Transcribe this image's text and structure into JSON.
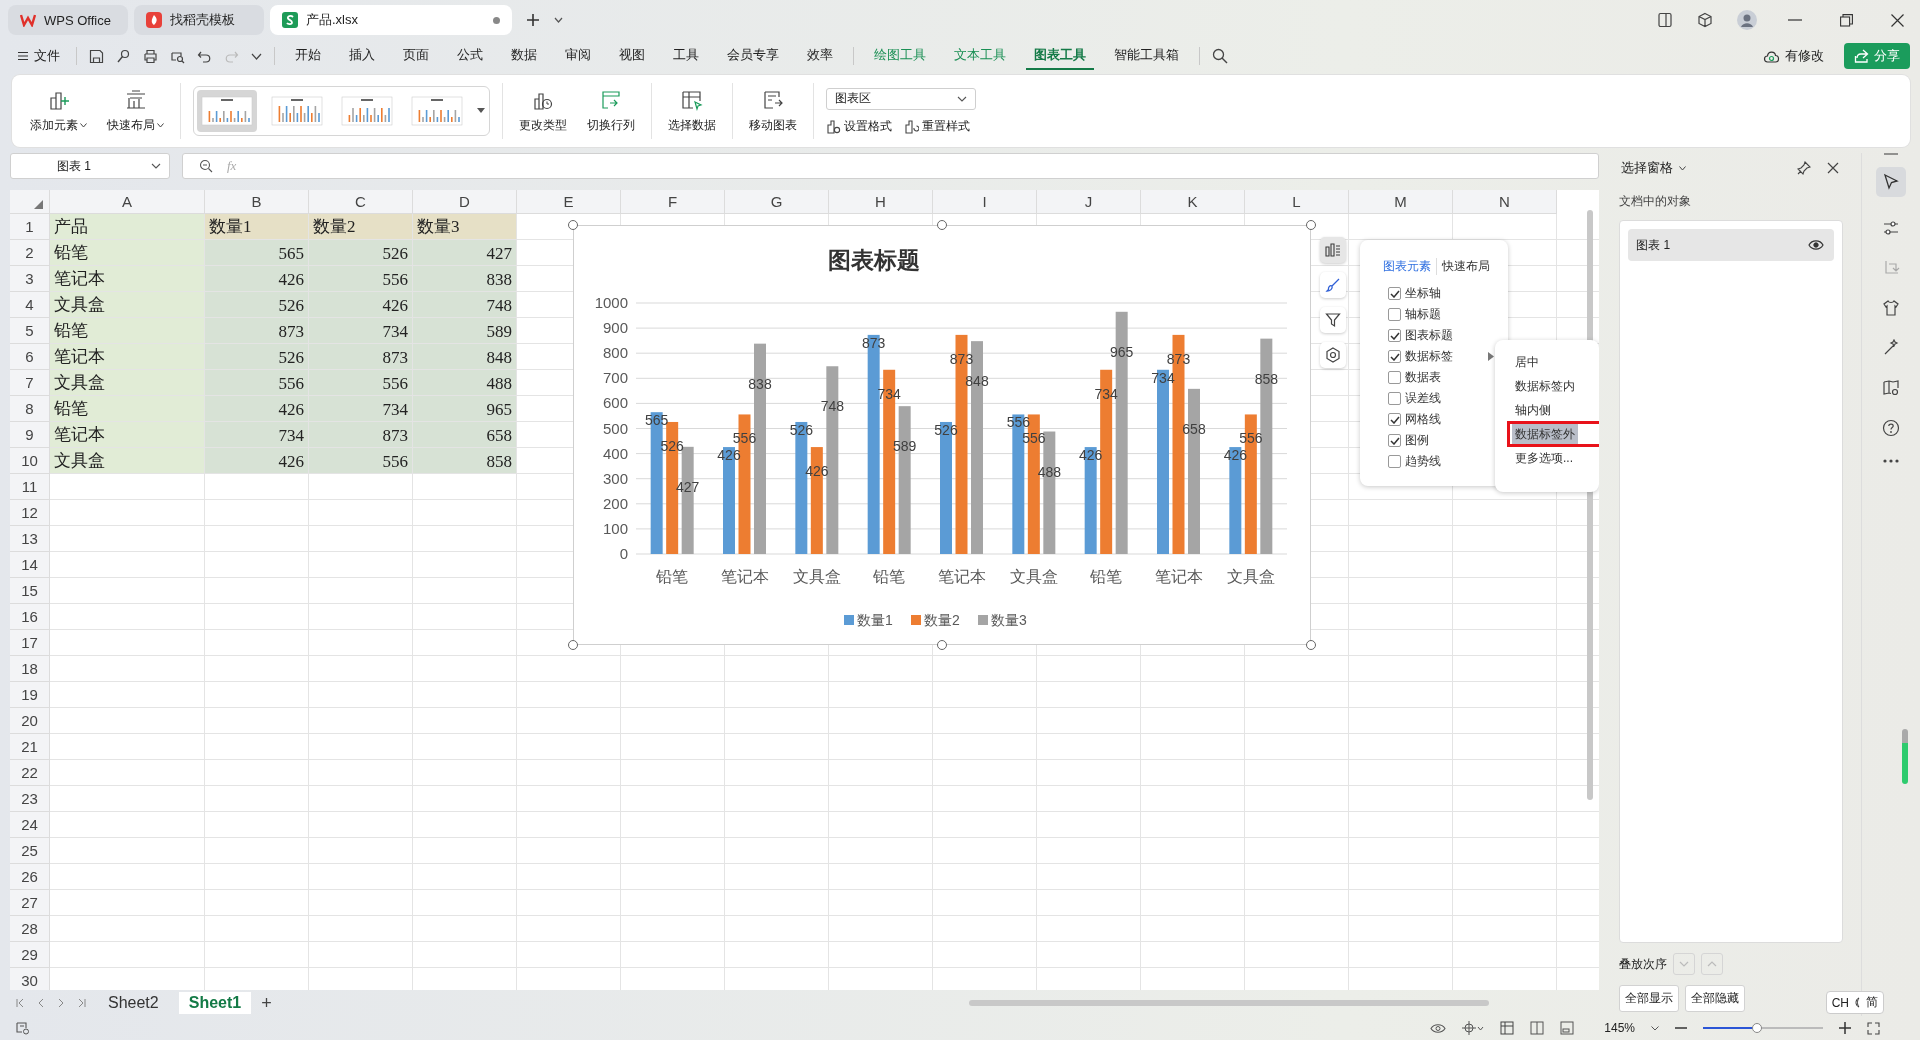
{
  "app_tabs": [
    {
      "label": "WPS Office",
      "kind": "wps",
      "selected": false,
      "modified": false
    },
    {
      "label": "找稻壳模板",
      "kind": "docer",
      "selected": false,
      "modified": false
    },
    {
      "label": "产品.xlsx",
      "kind": "sheet",
      "selected": true,
      "modified": true
    }
  ],
  "file_menu": "文件",
  "menu_tabs": [
    {
      "label": "开始",
      "kind": "main",
      "selected": false
    },
    {
      "label": "插入",
      "kind": "main",
      "selected": false
    },
    {
      "label": "页面",
      "kind": "main",
      "selected": false
    },
    {
      "label": "公式",
      "kind": "main",
      "selected": false
    },
    {
      "label": "数据",
      "kind": "main",
      "selected": false
    },
    {
      "label": "审阅",
      "kind": "main",
      "selected": false
    },
    {
      "label": "视图",
      "kind": "main",
      "selected": false
    },
    {
      "label": "工具",
      "kind": "main",
      "selected": false
    },
    {
      "label": "会员专享",
      "kind": "main",
      "selected": false
    },
    {
      "label": "效率",
      "kind": "main",
      "selected": false
    },
    {
      "label": "绘图工具",
      "kind": "tool",
      "selected": false
    },
    {
      "label": "文本工具",
      "kind": "tool",
      "selected": false
    },
    {
      "label": "图表工具",
      "kind": "tool",
      "selected": true
    },
    {
      "label": "智能工具箱",
      "kind": "main",
      "selected": false
    }
  ],
  "cloud_status": "有修改",
  "share_button": "分享",
  "ribbon": {
    "element_buttons": [
      {
        "label": "添加元素",
        "kind": "add"
      },
      {
        "label": "快速布局",
        "kind": "layout"
      }
    ],
    "chart_styles": [
      {
        "selected": true
      },
      {
        "selected": false
      },
      {
        "selected": false
      },
      {
        "selected": false
      }
    ],
    "buttons": [
      {
        "label": "更改类型",
        "kind": "type"
      },
      {
        "label": "切换行列",
        "kind": "switch"
      },
      {
        "label": "选择数据",
        "kind": "data"
      },
      {
        "label": "移动图表",
        "kind": "move"
      }
    ],
    "element_select": "图表区",
    "format_buttons": [
      {
        "label": "设置格式",
        "kind": "format"
      },
      {
        "label": "重置样式",
        "kind": "reset"
      }
    ]
  },
  "formula_bar": {
    "name_box": "图表 1",
    "fx": "fx"
  },
  "sheet": {
    "columns": [
      "A",
      "B",
      "C",
      "D",
      "E",
      "F",
      "G",
      "H",
      "I",
      "J",
      "K",
      "L",
      "M",
      "N"
    ],
    "rows": [
      "1",
      "2",
      "3",
      "4",
      "5",
      "6",
      "7",
      "8",
      "9",
      "10",
      "11",
      "12",
      "13",
      "14",
      "15",
      "16",
      "17",
      "18",
      "19",
      "20",
      "21",
      "22",
      "23",
      "24",
      "25",
      "26",
      "27",
      "28",
      "29",
      "30"
    ],
    "cells": [
      [
        "产品",
        "数量1",
        "数量2",
        "数量3"
      ],
      [
        "铅笔",
        "565",
        "526",
        "427"
      ],
      [
        "笔记本",
        "426",
        "556",
        "838"
      ],
      [
        "文具盒",
        "526",
        "426",
        "748"
      ],
      [
        "铅笔",
        "873",
        "734",
        "589"
      ],
      [
        "笔记本",
        "526",
        "873",
        "848"
      ],
      [
        "文具盒",
        "556",
        "556",
        "488"
      ],
      [
        "铅笔",
        "426",
        "734",
        "965"
      ],
      [
        "笔记本",
        "734",
        "873",
        "658"
      ],
      [
        "文具盒",
        "426",
        "556",
        "858"
      ]
    ]
  },
  "chart": {
    "chart_data": {
      "type": "bar",
      "title": "图表标题",
      "categories": [
        "铅笔",
        "笔记本",
        "文具盒",
        "铅笔",
        "笔记本",
        "文具盒",
        "铅笔",
        "笔记本",
        "文具盒"
      ],
      "series": [
        {
          "name": "数量1",
          "color": "#5b9bd5",
          "values": [
            565,
            426,
            526,
            873,
            526,
            556,
            426,
            734,
            426
          ]
        },
        {
          "name": "数量2",
          "color": "#ed7d31",
          "values": [
            526,
            556,
            426,
            734,
            873,
            556,
            734,
            873,
            556
          ]
        },
        {
          "name": "数量3",
          "color": "#a5a5a5",
          "values": [
            427,
            838,
            748,
            589,
            848,
            488,
            965,
            658,
            858
          ]
        }
      ],
      "ylim": [
        0,
        1000
      ],
      "yticks": [
        0,
        100,
        200,
        300,
        400,
        500,
        600,
        700,
        800,
        900,
        1000
      ],
      "value_labels": [
        [
          "565",
          "426",
          "526",
          "873",
          "526",
          "556",
          "426",
          "734",
          "426"
        ],
        [
          "526",
          "556",
          "426",
          "734",
          "873",
          "556",
          "734",
          "873",
          "556"
        ],
        [
          "427",
          "838",
          "748",
          "589",
          "848",
          "488",
          "965",
          "658",
          "858"
        ]
      ],
      "grid": true,
      "legend": true
    }
  },
  "chart_elements_panel": {
    "tabs": [
      {
        "label": "图表元素",
        "selected": true
      },
      {
        "label": "快速布局",
        "selected": false
      }
    ],
    "items": [
      {
        "label": "坐标轴",
        "checked": true,
        "submenu": false
      },
      {
        "label": "轴标题",
        "checked": false,
        "submenu": false
      },
      {
        "label": "图表标题",
        "checked": true,
        "submenu": false
      },
      {
        "label": "数据标签",
        "checked": true,
        "submenu": true
      },
      {
        "label": "数据表",
        "checked": false,
        "submenu": false
      },
      {
        "label": "误差线",
        "checked": false,
        "submenu": false
      },
      {
        "label": "网格线",
        "checked": true,
        "submenu": false
      },
      {
        "label": "图例",
        "checked": true,
        "submenu": false
      },
      {
        "label": "趋势线",
        "checked": false,
        "submenu": false
      }
    ]
  },
  "data_label_menu": [
    {
      "label": "居中",
      "selected": false,
      "outlined": false
    },
    {
      "label": "数据标签内",
      "selected": false,
      "outlined": false
    },
    {
      "label": "轴内侧",
      "selected": false,
      "outlined": false
    },
    {
      "label": "数据标签外",
      "selected": true,
      "outlined": true
    },
    {
      "label": "更多选项...",
      "selected": false,
      "outlined": false
    }
  ],
  "selection_pane": {
    "title": "选择窗格",
    "subtitle": "文档中的对象",
    "objects": [
      {
        "label": "图表 1",
        "visible": true
      }
    ],
    "order_label": "叠放次序",
    "buttons": [
      "全部显示",
      "全部隐藏"
    ]
  },
  "ime": {
    "language": "CH",
    "mode": "简"
  },
  "sheet_tabs": [
    {
      "label": "Sheet2",
      "selected": false
    },
    {
      "label": "Sheet1",
      "selected": true
    }
  ],
  "add_sheet": "+",
  "status_bar": {
    "zoom": "145%",
    "zoom_slider": {
      "level": 0.45
    }
  }
}
